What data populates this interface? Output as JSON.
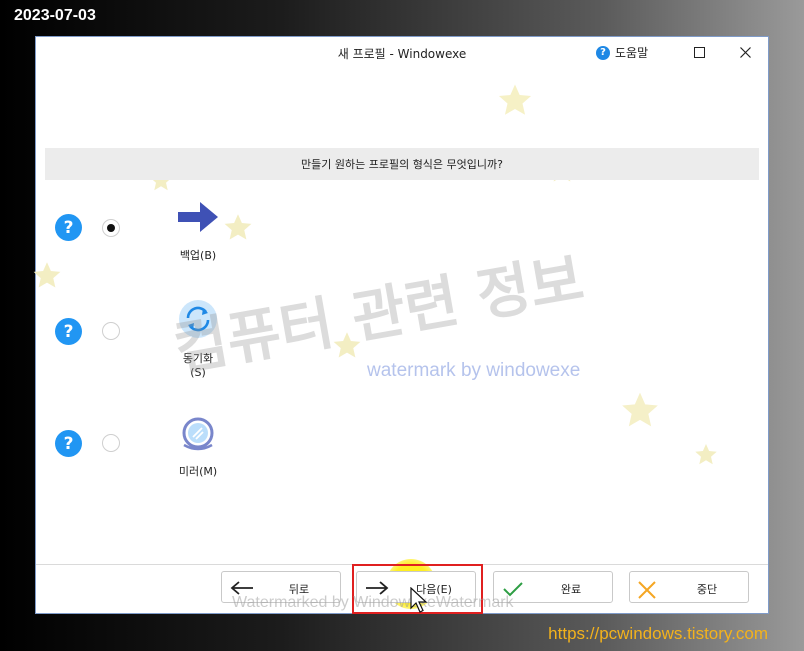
{
  "overlay": {
    "date_stamp": "2023-07-03",
    "site_url": "https://pcwindows.tistory.com"
  },
  "window": {
    "title": "새 프로필  - Windowexe",
    "help_label": "도움말",
    "help_badge": "?",
    "question": "만들기 원하는 프로필의 형식은 무엇입니까?"
  },
  "options": [
    {
      "label": "백업(B)",
      "selected": true,
      "icon": "arrow-right-icon",
      "help": "?"
    },
    {
      "label": "동기화(S)",
      "selected": false,
      "icon": "sync-icon",
      "help": "?"
    },
    {
      "label": "미러(M)",
      "selected": false,
      "icon": "mirror-icon",
      "help": "?"
    }
  ],
  "footer": {
    "back_label": "뒤로",
    "next_label": "다음(E)",
    "finish_label": "완료",
    "cancel_label": "중단"
  },
  "watermarks": {
    "korean": "컴퓨터 관련 정보",
    "english": "watermark by windowexe",
    "bottom": "Watermarked by WindowexeWatermark"
  },
  "colors": {
    "accent_blue": "#2196f3",
    "arrow_blue": "#3f51b5",
    "highlight_red": "#e02020",
    "url_orange": "#f3b21c",
    "check_green": "#2e9e44",
    "cancel_orange": "#f5a623"
  }
}
